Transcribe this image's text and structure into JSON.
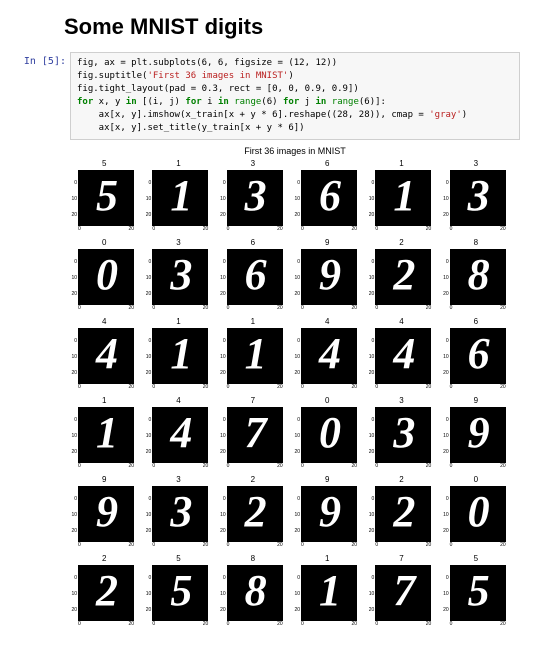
{
  "heading": "Some MNIST digits",
  "prompt": "In [5]:",
  "code": {
    "line1_a": "fig, ax = plt.subplots(",
    "line1_b": "6",
    "line1_c": ", ",
    "line1_d": "6",
    "line1_e": ", figsize = (",
    "line1_f": "12",
    "line1_g": ", ",
    "line1_h": "12",
    "line1_i": "))",
    "line2_a": "fig.suptitle(",
    "line2_b": "'First 36 images in MNIST'",
    "line2_c": ")",
    "line3_a": "fig.tight_layout(pad = ",
    "line3_b": "0.3",
    "line3_c": ", rect = [",
    "line3_d": "0",
    "line3_e": ", ",
    "line3_f": "0",
    "line3_g": ", ",
    "line3_h": "0.9",
    "line3_i": ", ",
    "line3_j": "0.9",
    "line3_k": "])",
    "line4_a": "for",
    "line4_b": " x, y ",
    "line4_c": "in",
    "line4_d": " [(i, j) ",
    "line4_e": "for",
    "line4_f": " i ",
    "line4_g": "in",
    "line4_h": " ",
    "line4_i": "range",
    "line4_j": "(",
    "line4_k": "6",
    "line4_l": ") ",
    "line4_m": "for",
    "line4_n": " j ",
    "line4_o": "in",
    "line4_p": " ",
    "line4_q": "range",
    "line4_r": "(",
    "line4_s": "6",
    "line4_t": ")]:",
    "line5_a": "    ax[x, y].imshow(x_train[x + y * ",
    "line5_b": "6",
    "line5_c": "].reshape((",
    "line5_d": "28",
    "line5_e": ", ",
    "line5_f": "28",
    "line5_g": ")), cmap = ",
    "line5_h": "'gray'",
    "line5_i": ")",
    "line6_a": "    ax[x, y].set_title(y_train[x + y * ",
    "line6_b": "6",
    "line6_c": "])"
  },
  "figure_title": "First 36 images in MNIST",
  "yticks": [
    "0",
    "10",
    "20"
  ],
  "xticks": [
    "0",
    "20"
  ],
  "chart_data": {
    "type": "grid",
    "rows": 6,
    "cols": 6,
    "subplots": [
      {
        "title": "5",
        "digit": "5"
      },
      {
        "title": "1",
        "digit": "1"
      },
      {
        "title": "3",
        "digit": "3"
      },
      {
        "title": "6",
        "digit": "6"
      },
      {
        "title": "1",
        "digit": "1"
      },
      {
        "title": "3",
        "digit": "3"
      },
      {
        "title": "0",
        "digit": "0"
      },
      {
        "title": "3",
        "digit": "3"
      },
      {
        "title": "6",
        "digit": "6"
      },
      {
        "title": "9",
        "digit": "9"
      },
      {
        "title": "2",
        "digit": "2"
      },
      {
        "title": "8",
        "digit": "8"
      },
      {
        "title": "4",
        "digit": "4"
      },
      {
        "title": "1",
        "digit": "1"
      },
      {
        "title": "1",
        "digit": "1"
      },
      {
        "title": "4",
        "digit": "4"
      },
      {
        "title": "4",
        "digit": "4"
      },
      {
        "title": "6",
        "digit": "6"
      },
      {
        "title": "1",
        "digit": "1"
      },
      {
        "title": "4",
        "digit": "4"
      },
      {
        "title": "7",
        "digit": "7"
      },
      {
        "title": "0",
        "digit": "0"
      },
      {
        "title": "3",
        "digit": "3"
      },
      {
        "title": "9",
        "digit": "9"
      },
      {
        "title": "9",
        "digit": "9"
      },
      {
        "title": "3",
        "digit": "3"
      },
      {
        "title": "2",
        "digit": "2"
      },
      {
        "title": "9",
        "digit": "9"
      },
      {
        "title": "2",
        "digit": "2"
      },
      {
        "title": "0",
        "digit": "0"
      },
      {
        "title": "2",
        "digit": "2"
      },
      {
        "title": "5",
        "digit": "5"
      },
      {
        "title": "8",
        "digit": "8"
      },
      {
        "title": "1",
        "digit": "1"
      },
      {
        "title": "7",
        "digit": "7"
      },
      {
        "title": "5",
        "digit": "5"
      }
    ]
  }
}
